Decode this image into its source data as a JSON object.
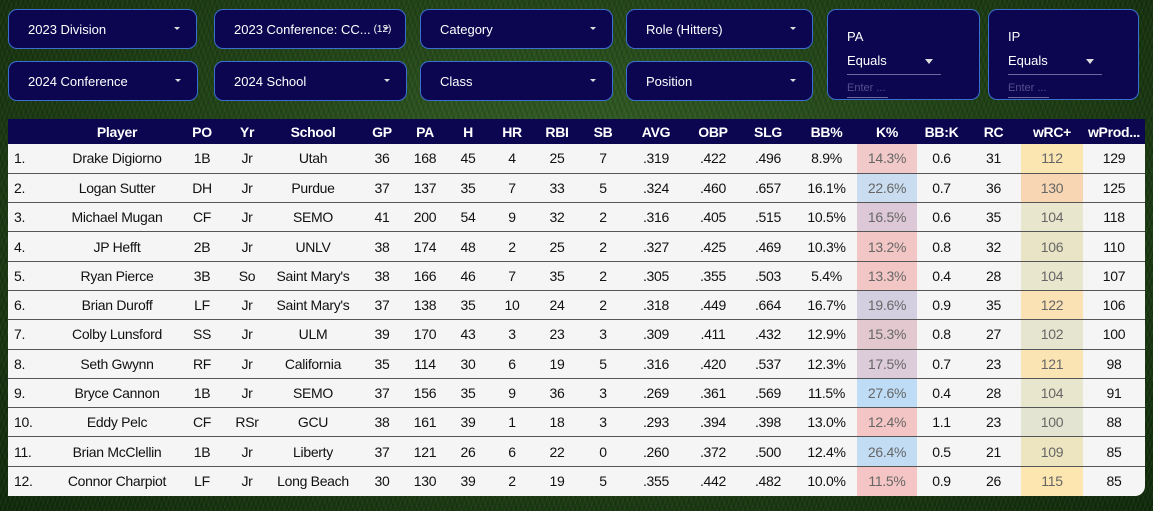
{
  "filters": {
    "division_2023": "2023 Division",
    "conference_2023": "2023 Conference: CC...",
    "conference_2023_count": "(12)",
    "category": "Category",
    "role": "Role (Hitters)",
    "conference_2024": "2024 Conference",
    "school_2024": "2024 School",
    "class": "Class",
    "position": "Position",
    "pa": {
      "label": "PA",
      "operator": "Equals",
      "placeholder": "Enter ..."
    },
    "ip": {
      "label": "IP",
      "operator": "Equals",
      "placeholder": "Enter ..."
    }
  },
  "table": {
    "columns": [
      "",
      "Player",
      "PO",
      "Yr",
      "School",
      "GP",
      "PA",
      "H",
      "HR",
      "RBI",
      "SB",
      "AVG",
      "OBP",
      "SLG",
      "BB%",
      "K%",
      "BB:K",
      "RC",
      "wRC+",
      "wProd..."
    ],
    "rows": [
      [
        "1.",
        "Drake Digiorno",
        "1B",
        "Jr",
        "Utah",
        "36",
        "168",
        "45",
        "4",
        "25",
        "7",
        ".319",
        ".422",
        ".496",
        "8.9%",
        "14.3%",
        "0.6",
        "31",
        "112",
        "129"
      ],
      [
        "2.",
        "Logan Sutter",
        "DH",
        "Jr",
        "Purdue",
        "37",
        "137",
        "35",
        "7",
        "33",
        "5",
        ".324",
        ".460",
        ".657",
        "16.1%",
        "22.6%",
        "0.7",
        "36",
        "130",
        "125"
      ],
      [
        "3.",
        "Michael Mugan",
        "CF",
        "Jr",
        "SEMO",
        "41",
        "200",
        "54",
        "9",
        "32",
        "2",
        ".316",
        ".405",
        ".515",
        "10.5%",
        "16.5%",
        "0.6",
        "35",
        "104",
        "118"
      ],
      [
        "4.",
        "JP Hefft",
        "2B",
        "Jr",
        "UNLV",
        "38",
        "174",
        "48",
        "2",
        "25",
        "2",
        ".327",
        ".425",
        ".469",
        "10.3%",
        "13.2%",
        "0.8",
        "32",
        "106",
        "110"
      ],
      [
        "5.",
        "Ryan Pierce",
        "3B",
        "So",
        "Saint Mary's",
        "38",
        "166",
        "46",
        "7",
        "35",
        "2",
        ".305",
        ".355",
        ".503",
        "5.4%",
        "13.3%",
        "0.4",
        "28",
        "104",
        "107"
      ],
      [
        "6.",
        "Brian Duroff",
        "LF",
        "Jr",
        "Saint Mary's",
        "37",
        "138",
        "35",
        "10",
        "24",
        "2",
        ".318",
        ".449",
        ".664",
        "16.7%",
        "19.6%",
        "0.9",
        "35",
        "122",
        "106"
      ],
      [
        "7.",
        "Colby Lunsford",
        "SS",
        "Jr",
        "ULM",
        "39",
        "170",
        "43",
        "3",
        "23",
        "3",
        ".309",
        ".411",
        ".432",
        "12.9%",
        "15.3%",
        "0.8",
        "27",
        "102",
        "100"
      ],
      [
        "8.",
        "Seth Gwynn",
        "RF",
        "Jr",
        "California",
        "35",
        "114",
        "30",
        "6",
        "19",
        "5",
        ".316",
        ".420",
        ".537",
        "12.3%",
        "17.5%",
        "0.7",
        "23",
        "121",
        "98"
      ],
      [
        "9.",
        "Bryce Cannon",
        "1B",
        "Jr",
        "SEMO",
        "37",
        "156",
        "35",
        "9",
        "36",
        "3",
        ".269",
        ".361",
        ".569",
        "11.5%",
        "27.6%",
        "0.4",
        "28",
        "104",
        "91"
      ],
      [
        "10.",
        "Eddy Pelc",
        "CF",
        "RSr",
        "GCU",
        "38",
        "161",
        "39",
        "1",
        "18",
        "3",
        ".293",
        ".394",
        ".398",
        "13.0%",
        "12.4%",
        "1.1",
        "23",
        "100",
        "88"
      ],
      [
        "11.",
        "Brian McClellin",
        "1B",
        "Jr",
        "Liberty",
        "37",
        "121",
        "26",
        "6",
        "22",
        "0",
        ".260",
        ".372",
        ".500",
        "12.4%",
        "26.4%",
        "0.5",
        "21",
        "109",
        "85"
      ],
      [
        "12.",
        "Connor Charpiot",
        "LF",
        "Jr",
        "Long Beach",
        "30",
        "130",
        "39",
        "2",
        "19",
        "5",
        ".355",
        ".442",
        ".482",
        "10.0%",
        "11.5%",
        "0.9",
        "26",
        "115",
        "85"
      ]
    ],
    "k_pct_colors": [
      "#f1c9c9",
      "#c9dcf0",
      "#dcc8d6",
      "#f3c6c6",
      "#f3c6c6",
      "#d3cfe0",
      "#e3c8d0",
      "#dccbd8",
      "#bedcf5",
      "#f4c5c5",
      "#c2dcf4",
      "#f5c4c4"
    ],
    "wrc_plus_colors": [
      "#fbe6b2",
      "#f9d6b3",
      "#e8e6cc",
      "#eae4c6",
      "#e8e6cc",
      "#fbe2b4",
      "#e6e5d0",
      "#fbe4b4",
      "#e8e6cc",
      "#e4e4d2",
      "#ede4c0",
      "#fde6b0"
    ]
  }
}
